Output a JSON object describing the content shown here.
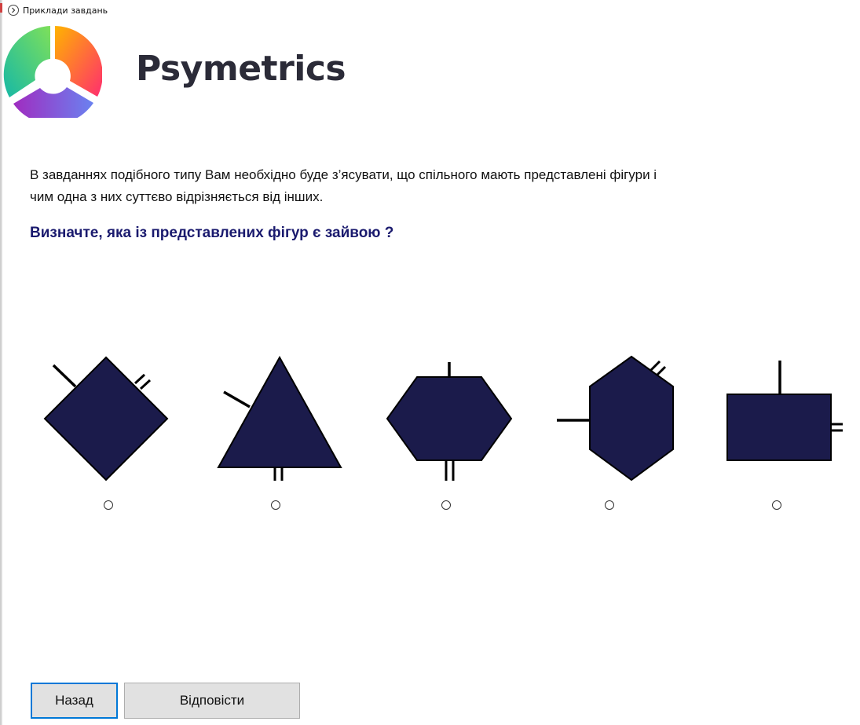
{
  "window": {
    "title": "Приклади завдань",
    "chevron_icon": "chevron-right-circle-icon"
  },
  "brand": {
    "name": "Psymetrics",
    "logo_colors": [
      "#ffb300",
      "#ff2d6f",
      "#6a82f0",
      "#a02cc0",
      "#16b8a6",
      "#7ee05a"
    ]
  },
  "content": {
    "intro_line1": "В завданнях подібного типу Вам необхідно буде з’ясувати, що спільного мають представлені фігури і",
    "intro_line2": "чим одна з них суттєво відрізняється від інших.",
    "question": "Визначте, яка із представлених фігур є зайвою ?"
  },
  "figures": {
    "fill": "#1b1b4b",
    "items": [
      {
        "shape": "diamond",
        "selected": false
      },
      {
        "shape": "triangle",
        "selected": false
      },
      {
        "shape": "hexagon-horizontal",
        "selected": false
      },
      {
        "shape": "hexagon-vertical",
        "selected": false
      },
      {
        "shape": "rectangle",
        "selected": false
      }
    ]
  },
  "buttons": {
    "back": "Назад",
    "answer": "Відповісти"
  }
}
